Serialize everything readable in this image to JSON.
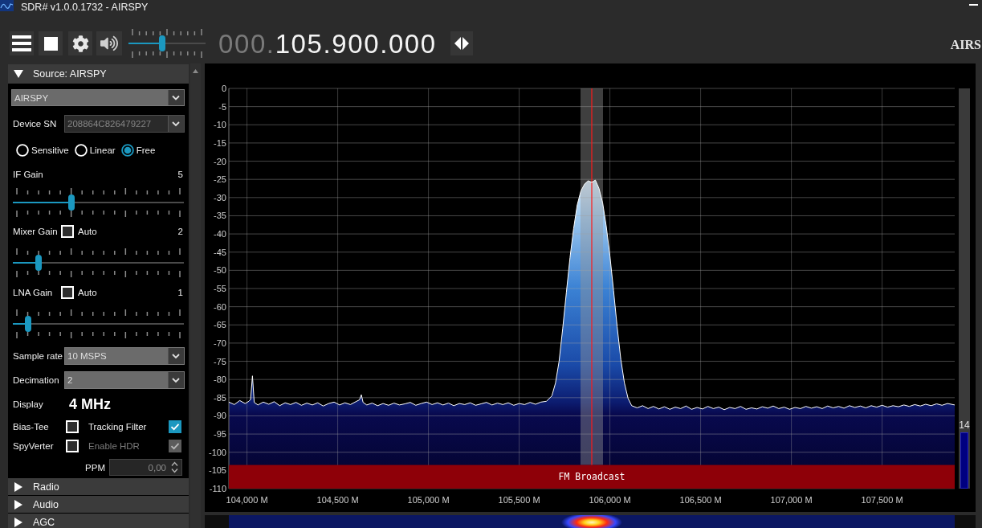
{
  "window": {
    "title": "SDR# v1.0.0.1732 - AIRSPY"
  },
  "toolbar": {
    "volume": {
      "level": 0.43
    },
    "frequency": {
      "prefix": "000.",
      "value": "105.900.000"
    },
    "logo": "AIRS"
  },
  "source_panel": {
    "title": "Source: AIRSPY",
    "expanded": true,
    "device": {
      "value": "AIRSPY",
      "disabled": false
    },
    "device_sn": {
      "label": "Device SN",
      "value": "208864C826479227",
      "disabled": true
    },
    "modes": [
      {
        "label": "Sensitive",
        "selected": false
      },
      {
        "label": "Linear",
        "selected": false
      },
      {
        "label": "Free",
        "selected": true
      }
    ],
    "gains": [
      {
        "label": "IF Gain",
        "value": "5",
        "level": 0.333
      },
      {
        "label": "Mixer Gain",
        "auto": {
          "label": "Auto",
          "checked": false
        },
        "value": "2",
        "level": 0.133
      },
      {
        "label": "LNA Gain",
        "auto": {
          "label": "Auto",
          "checked": false
        },
        "value": "1",
        "level": 0.067
      }
    ],
    "sample_rate": {
      "label": "Sample rate",
      "value": "10 MSPS",
      "disabled": false
    },
    "decimation": {
      "label": "Decimation",
      "value": "2",
      "disabled": false
    },
    "display": {
      "label": "Display",
      "value": "4 MHz"
    },
    "options": [
      {
        "label": "Bias-Tee",
        "checked": false,
        "disabled": false
      },
      {
        "label": "Tracking Filter",
        "checked": true,
        "disabled": false
      },
      {
        "label": "SpyVerter",
        "checked": false,
        "disabled": false
      },
      {
        "label": "Enable HDR",
        "checked": true,
        "disabled": true
      }
    ],
    "ppm": {
      "label": "PPM",
      "value": "0,00",
      "disabled": true
    }
  },
  "sections": [
    {
      "title": "Radio",
      "expanded": false
    },
    {
      "title": "Audio",
      "expanded": false
    },
    {
      "title": "AGC",
      "expanded": false
    }
  ],
  "spectrum": {
    "chart_data": {
      "type": "area",
      "grid": true,
      "xlim": [
        103900,
        107900
      ],
      "ylim": [
        -110,
        0
      ],
      "xticks": [
        {
          "value": 104000,
          "label": "104,000 M"
        },
        {
          "value": 104500,
          "label": "104,500 M"
        },
        {
          "value": 105000,
          "label": "105,000 M"
        },
        {
          "value": 105500,
          "label": "105,500 M"
        },
        {
          "value": 106000,
          "label": "106,000 M"
        },
        {
          "value": 106500,
          "label": "106,500 M"
        },
        {
          "value": 107000,
          "label": "107,000 M"
        },
        {
          "value": 107500,
          "label": "107,500 M"
        }
      ],
      "yticks": [
        0,
        -5,
        -10,
        -15,
        -20,
        -25,
        -30,
        -35,
        -40,
        -45,
        -50,
        -55,
        -60,
        -65,
        -70,
        -75,
        -80,
        -85,
        -90,
        -95,
        -100,
        -105,
        -110
      ],
      "x": [
        103900,
        103900,
        103930,
        103960,
        103990,
        104010,
        104020,
        104030,
        104040,
        104060,
        104090,
        104120,
        104150,
        104180,
        104210,
        104240,
        104270,
        104300,
        104330,
        104360,
        104390,
        104420,
        104450,
        104480,
        104510,
        104540,
        104570,
        104600,
        104620,
        104630,
        104640,
        104660,
        104690,
        104720,
        104750,
        104780,
        104810,
        104840,
        104870,
        104900,
        104930,
        104960,
        104990,
        105020,
        105050,
        105080,
        105110,
        105140,
        105170,
        105200,
        105230,
        105260,
        105290,
        105320,
        105350,
        105380,
        105410,
        105440,
        105470,
        105500,
        105530,
        105560,
        105590,
        105620,
        105650,
        105680,
        105700,
        105720,
        105740,
        105760,
        105780,
        105800,
        105820,
        105840,
        105860,
        105880,
        105900,
        105920,
        105940,
        105960,
        105980,
        106000,
        106020,
        106040,
        106060,
        106080,
        106100,
        106120,
        106150,
        106180,
        106210,
        106240,
        106270,
        106300,
        106330,
        106360,
        106390,
        106420,
        106450,
        106480,
        106510,
        106540,
        106570,
        106600,
        106630,
        106660,
        106690,
        106720,
        106750,
        106780,
        106810,
        106840,
        106870,
        106900,
        106930,
        106960,
        106990,
        107020,
        107050,
        107080,
        107110,
        107140,
        107170,
        107200,
        107230,
        107260,
        107290,
        107320,
        107350,
        107380,
        107410,
        107440,
        107470,
        107500,
        107530,
        107560,
        107590,
        107620,
        107650,
        107680,
        107710,
        107740,
        107770,
        107800,
        107830,
        107860,
        107900,
        107900
      ],
      "values": [
        -110,
        -86.2,
        -86.9,
        -85.8,
        -86.6,
        -86.0,
        -85.5,
        -79.0,
        -86.3,
        -87.0,
        -86.2,
        -86.8,
        -86.1,
        -87.2,
        -86.4,
        -86.9,
        -86.3,
        -87.1,
        -86.5,
        -87.0,
        -86.4,
        -87.3,
        -86.6,
        -86.2,
        -87.0,
        -86.4,
        -86.9,
        -86.1,
        -85.6,
        -84.2,
        -86.3,
        -87.0,
        -86.5,
        -87.2,
        -86.6,
        -87.1,
        -86.5,
        -87.0,
        -86.7,
        -86.3,
        -87.1,
        -86.6,
        -86.2,
        -86.9,
        -86.4,
        -87.0,
        -86.5,
        -87.2,
        -86.6,
        -86.9,
        -86.4,
        -87.1,
        -86.7,
        -86.3,
        -87.0,
        -86.5,
        -86.9,
        -86.4,
        -87.1,
        -86.6,
        -86.9,
        -86.3,
        -86.8,
        -86.2,
        -86.0,
        -84.5,
        -81.0,
        -75.0,
        -66.0,
        -56.0,
        -46.5,
        -38.5,
        -32.0,
        -28.2,
        -26.3,
        -25.4,
        -25.8,
        -25.2,
        -27.5,
        -31.5,
        -38.0,
        -46.0,
        -55.5,
        -65.5,
        -74.5,
        -81.0,
        -85.2,
        -87.2,
        -87.8,
        -87.2,
        -88.0,
        -87.4,
        -88.1,
        -87.5,
        -88.2,
        -87.6,
        -88.0,
        -87.3,
        -88.2,
        -87.7,
        -88.1,
        -87.4,
        -88.0,
        -87.6,
        -88.3,
        -87.7,
        -88.0,
        -87.4,
        -88.2,
        -87.8,
        -88.1,
        -87.5,
        -87.9,
        -87.3,
        -88.0,
        -87.6,
        -88.2,
        -87.7,
        -88.0,
        -87.4,
        -87.9,
        -87.5,
        -88.0,
        -87.3,
        -87.8,
        -87.4,
        -87.9,
        -87.2,
        -87.7,
        -87.3,
        -87.8,
        -87.2,
        -87.6,
        -87.1,
        -87.6,
        -87.2,
        -87.5,
        -87.0,
        -87.4,
        -86.9,
        -87.3,
        -86.8,
        -87.2,
        -86.7,
        -87.1,
        -86.6,
        -87.0,
        -110
      ],
      "bands": [
        {
          "axis": "x",
          "from": 105838,
          "to": 105962
        },
        {
          "axis": "y",
          "from": -110,
          "to": -103.5,
          "label": "FM Broadcast"
        }
      ],
      "ref_lines": [
        {
          "axis": "x",
          "value": 105900
        }
      ]
    },
    "meter": {
      "reading": "14",
      "level": 0.14
    }
  }
}
